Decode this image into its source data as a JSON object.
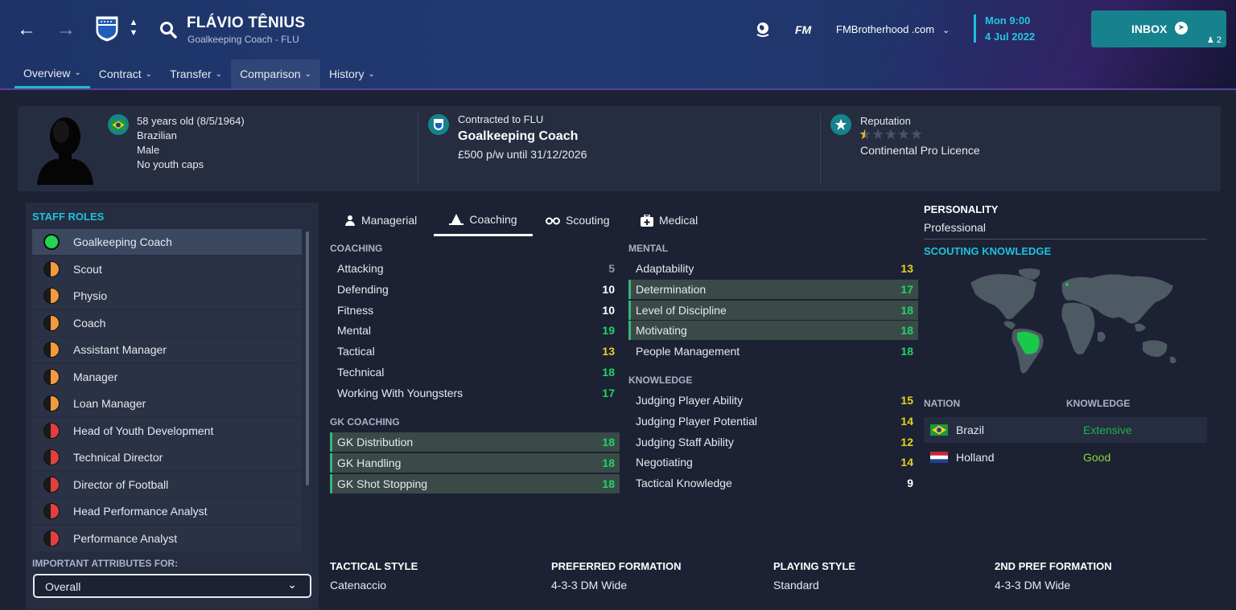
{
  "header": {
    "name": "FLÁVIO TÊNIUS",
    "subtitle": "Goalkeeping Coach - FLU",
    "brand": "FM",
    "site": "FMBrotherhood .com",
    "day_time": "Mon 9:00",
    "date": "4 Jul 2022",
    "inbox_label": "INBOX",
    "inbox_count": "2",
    "tabs": [
      {
        "label": "Overview"
      },
      {
        "label": "Contract"
      },
      {
        "label": "Transfer"
      },
      {
        "label": "Comparison"
      },
      {
        "label": "History"
      }
    ]
  },
  "profile": {
    "age": "58 years old (8/5/1964)",
    "nationality": "Brazilian",
    "gender": "Male",
    "caps": "No youth caps",
    "contracted_to": "Contracted to FLU",
    "job": "Goalkeeping Coach",
    "wage": "£500 p/w until 31/12/2026",
    "reputation_label": "Reputation",
    "reputation_stars": 0.5,
    "licence": "Continental Pro Licence"
  },
  "staff_roles": {
    "title": "STAFF ROLES",
    "roles": [
      {
        "label": "Goalkeeping Coach",
        "status": "green"
      },
      {
        "label": "Scout",
        "status": "orange"
      },
      {
        "label": "Physio",
        "status": "orange"
      },
      {
        "label": "Coach",
        "status": "orange"
      },
      {
        "label": "Assistant Manager",
        "status": "orange"
      },
      {
        "label": "Manager",
        "status": "orange"
      },
      {
        "label": "Loan Manager",
        "status": "orange"
      },
      {
        "label": "Head of Youth Development",
        "status": "red"
      },
      {
        "label": "Technical Director",
        "status": "red"
      },
      {
        "label": "Director of Football",
        "status": "red"
      },
      {
        "label": "Head Performance Analyst",
        "status": "red"
      },
      {
        "label": "Performance Analyst",
        "status": "red"
      }
    ],
    "important_label": "IMPORTANT ATTRIBUTES FOR:",
    "dropdown_value": "Overall"
  },
  "attribute_tabs": [
    {
      "label": "Managerial"
    },
    {
      "label": "Coaching"
    },
    {
      "label": "Scouting"
    },
    {
      "label": "Medical"
    }
  ],
  "coaching": {
    "title": "COACHING",
    "items": [
      {
        "label": "Attacking",
        "value": "5"
      },
      {
        "label": "Defending",
        "value": "10"
      },
      {
        "label": "Fitness",
        "value": "10"
      },
      {
        "label": "Mental",
        "value": "19"
      },
      {
        "label": "Tactical",
        "value": "13"
      },
      {
        "label": "Technical",
        "value": "18"
      },
      {
        "label": "Working With Youngsters",
        "value": "17"
      }
    ]
  },
  "gk_coaching": {
    "title": "GK COACHING",
    "items": [
      {
        "label": "GK Distribution",
        "value": "18"
      },
      {
        "label": "GK Handling",
        "value": "18"
      },
      {
        "label": "GK Shot Stopping",
        "value": "18"
      }
    ]
  },
  "mental": {
    "title": "MENTAL",
    "items": [
      {
        "label": "Adaptability",
        "value": "13"
      },
      {
        "label": "Determination",
        "value": "17"
      },
      {
        "label": "Level of Discipline",
        "value": "18"
      },
      {
        "label": "Motivating",
        "value": "18"
      },
      {
        "label": "People Management",
        "value": "18"
      }
    ]
  },
  "knowledge": {
    "title": "KNOWLEDGE",
    "items": [
      {
        "label": "Judging Player Ability",
        "value": "15"
      },
      {
        "label": "Judging Player Potential",
        "value": "14"
      },
      {
        "label": "Judging Staff Ability",
        "value": "12"
      },
      {
        "label": "Negotiating",
        "value": "14"
      },
      {
        "label": "Tactical Knowledge",
        "value": "9"
      }
    ]
  },
  "personality": {
    "title": "PERSONALITY",
    "value": "Professional"
  },
  "scouting_knowledge": {
    "title": "SCOUTING KNOWLEDGE",
    "nation_header": "NATION",
    "knowledge_header": "KNOWLEDGE",
    "rows": [
      {
        "nation": "Brazil",
        "knowledge": "Extensive"
      },
      {
        "nation": "Holland",
        "knowledge": "Good"
      }
    ]
  },
  "styles": {
    "tactical_style_label": "TACTICAL STYLE",
    "tactical_style": "Catenaccio",
    "pref_formation_label": "PREFERRED FORMATION",
    "pref_formation": "4-3-3 DM Wide",
    "playing_style_label": "PLAYING STYLE",
    "playing_style": "Standard",
    "second_formation_label": "2ND PREF FORMATION",
    "second_formation": "4-3-3 DM Wide"
  },
  "colors": {
    "accent": "#1fc1dd",
    "inbox": "#16828e",
    "attr_green": "#1fd46a",
    "attr_yellow": "#e4d220"
  }
}
